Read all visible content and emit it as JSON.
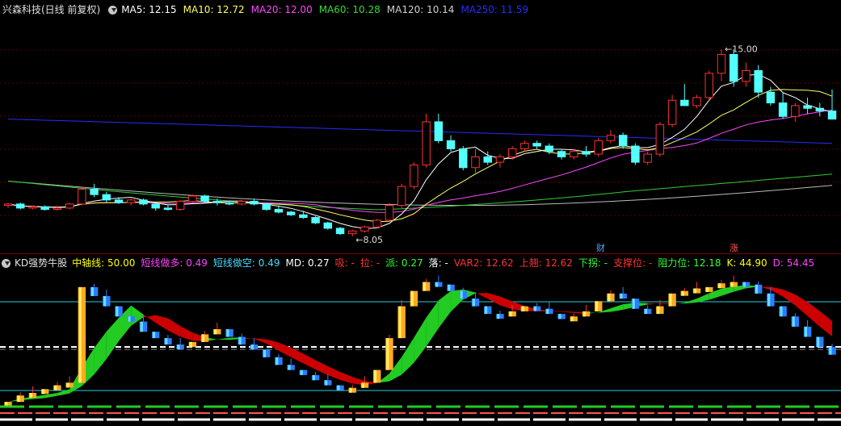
{
  "main": {
    "title": "兴森科技(日线 前复权)",
    "ma": [
      {
        "label": "MA5: 12.15",
        "color": "#ffffff"
      },
      {
        "label": "MA10: 12.72",
        "color": "#ffff55"
      },
      {
        "label": "MA20: 12.00",
        "color": "#ff44ff"
      },
      {
        "label": "MA60: 10.28",
        "color": "#33dd33"
      },
      {
        "label": "MA120: 10.14",
        "color": "#cfcfcf"
      },
      {
        "label": "MA250: 11.59",
        "color": "#2a2aff"
      }
    ],
    "high_label": "15.00",
    "low_label": "8.05",
    "event_cai": "财",
    "event_zhang": "涨",
    "candles": [
      [
        9.2,
        9.3,
        9.1,
        9.25
      ],
      [
        9.25,
        9.3,
        9.05,
        9.1
      ],
      [
        9.1,
        9.2,
        9.05,
        9.15
      ],
      [
        9.15,
        9.2,
        9.0,
        9.05
      ],
      [
        9.05,
        9.2,
        9.0,
        9.1
      ],
      [
        9.1,
        9.3,
        9.05,
        9.25
      ],
      [
        9.25,
        9.9,
        9.2,
        9.8
      ],
      [
        9.8,
        10.0,
        9.5,
        9.6
      ],
      [
        9.6,
        9.7,
        9.3,
        9.4
      ],
      [
        9.4,
        9.5,
        9.25,
        9.3
      ],
      [
        9.3,
        9.45,
        9.2,
        9.4
      ],
      [
        9.4,
        9.45,
        9.2,
        9.25
      ],
      [
        9.25,
        9.3,
        9.0,
        9.1
      ],
      [
        9.1,
        9.2,
        9.0,
        9.05
      ],
      [
        9.05,
        9.4,
        9.0,
        9.35
      ],
      [
        9.35,
        9.6,
        9.3,
        9.55
      ],
      [
        9.55,
        9.6,
        9.3,
        9.35
      ],
      [
        9.35,
        9.45,
        9.2,
        9.3
      ],
      [
        9.3,
        9.35,
        9.2,
        9.25
      ],
      [
        9.25,
        9.4,
        9.2,
        9.35
      ],
      [
        9.35,
        9.45,
        9.2,
        9.25
      ],
      [
        9.25,
        9.3,
        9.0,
        9.05
      ],
      [
        9.05,
        9.2,
        8.9,
        8.95
      ],
      [
        8.95,
        9.0,
        8.8,
        8.85
      ],
      [
        8.85,
        9.0,
        8.7,
        8.75
      ],
      [
        8.75,
        8.8,
        8.5,
        8.55
      ],
      [
        8.55,
        8.6,
        8.3,
        8.35
      ],
      [
        8.35,
        8.4,
        8.1,
        8.15
      ],
      [
        8.15,
        8.3,
        8.05,
        8.25
      ],
      [
        8.25,
        8.45,
        8.2,
        8.4
      ],
      [
        8.4,
        8.7,
        8.35,
        8.65
      ],
      [
        8.65,
        9.3,
        8.6,
        9.2
      ],
      [
        9.2,
        10.0,
        9.1,
        9.9
      ],
      [
        9.9,
        10.8,
        9.8,
        10.7
      ],
      [
        10.7,
        12.6,
        10.6,
        12.3
      ],
      [
        12.3,
        12.6,
        11.5,
        11.6
      ],
      [
        11.6,
        11.8,
        11.2,
        11.3
      ],
      [
        11.3,
        11.4,
        10.5,
        10.6
      ],
      [
        10.6,
        11.3,
        10.4,
        11.0
      ],
      [
        11.0,
        11.2,
        10.7,
        10.8
      ],
      [
        10.8,
        11.1,
        10.6,
        11.0
      ],
      [
        11.0,
        11.4,
        10.9,
        11.3
      ],
      [
        11.3,
        11.6,
        11.2,
        11.5
      ],
      [
        11.5,
        11.6,
        11.3,
        11.4
      ],
      [
        11.4,
        11.5,
        11.1,
        11.2
      ],
      [
        11.2,
        11.3,
        10.9,
        11.0
      ],
      [
        11.0,
        11.3,
        10.9,
        11.2
      ],
      [
        11.2,
        11.4,
        11.0,
        11.1
      ],
      [
        11.1,
        11.7,
        11.0,
        11.6
      ],
      [
        11.6,
        12.0,
        11.5,
        11.8
      ],
      [
        11.8,
        11.9,
        11.3,
        11.4
      ],
      [
        11.4,
        11.5,
        10.7,
        10.8
      ],
      [
        10.8,
        11.2,
        10.7,
        11.1
      ],
      [
        11.1,
        12.3,
        11.0,
        12.2
      ],
      [
        12.2,
        13.3,
        12.1,
        13.1
      ],
      [
        13.1,
        13.7,
        12.9,
        12.9
      ],
      [
        12.9,
        13.3,
        12.8,
        13.2
      ],
      [
        13.2,
        14.2,
        13.1,
        14.1
      ],
      [
        14.1,
        15.0,
        13.8,
        14.8
      ],
      [
        14.8,
        15.0,
        13.6,
        13.8
      ],
      [
        13.8,
        14.5,
        13.6,
        14.2
      ],
      [
        14.2,
        14.4,
        13.2,
        13.4
      ],
      [
        13.4,
        13.6,
        12.9,
        13.0
      ],
      [
        13.0,
        13.4,
        12.4,
        12.5
      ],
      [
        12.5,
        13.0,
        12.3,
        12.9
      ],
      [
        12.9,
        13.2,
        12.6,
        12.8
      ],
      [
        12.8,
        13.0,
        12.5,
        12.7
      ],
      [
        12.7,
        13.5,
        12.4,
        12.4
      ]
    ]
  },
  "indicator": {
    "title": "KD强势牛股",
    "items": [
      {
        "label": "中轴线: 50.00",
        "color": "#ffff00"
      },
      {
        "label": "短线做多: 0.49",
        "color": "#ff44ff"
      },
      {
        "label": "短线做空: 0.49",
        "color": "#44ddff"
      },
      {
        "label": "MD: 0.27",
        "color": "#ffffff"
      },
      {
        "label": "吸: -",
        "color": "#ff3333"
      },
      {
        "label": "拉: -",
        "color": "#ff3333"
      },
      {
        "label": "派: 0.27",
        "color": "#33ff33"
      },
      {
        "label": "落: -",
        "color": "#ffffff"
      },
      {
        "label": "VAR2: 12.62",
        "color": "#ff3333"
      },
      {
        "label": "上翘: 12.62",
        "color": "#ff3333"
      },
      {
        "label": "下拐: -",
        "color": "#33ff33"
      },
      {
        "label": "支撑位: -",
        "color": "#ff3333"
      },
      {
        "label": "阻力位: 12.18",
        "color": "#33ff33"
      },
      {
        "label": "K: 44.90",
        "color": "#ffff00"
      },
      {
        "label": "D: 54.45",
        "color": "#ff44ff"
      }
    ],
    "k_values": [
      5,
      10,
      12,
      15,
      18,
      20,
      95,
      88,
      80,
      72,
      68,
      60,
      55,
      50,
      48,
      52,
      58,
      62,
      56,
      50,
      46,
      40,
      34,
      30,
      26,
      22,
      18,
      15,
      16,
      20,
      30,
      55,
      80,
      92,
      99,
      97,
      92,
      86,
      80,
      74,
      72,
      76,
      80,
      78,
      74,
      70,
      72,
      76,
      84,
      90,
      86,
      78,
      74,
      80,
      90,
      92,
      94,
      95,
      98,
      99,
      97,
      90,
      80,
      72,
      64,
      56,
      48,
      42
    ]
  },
  "colors": {
    "up": "#ff3030",
    "down": "#54ffff",
    "cyan_line": "#20d0e0",
    "red_sep": "#7a0000"
  }
}
